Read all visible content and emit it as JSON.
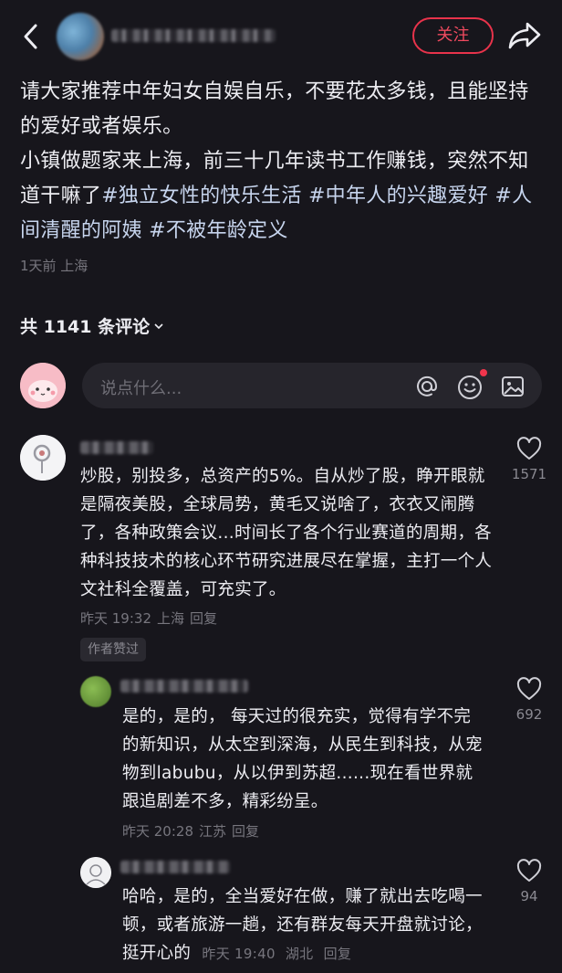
{
  "header": {
    "back_icon": "chevron-left-icon",
    "follow_label": "关注",
    "share_icon": "share-arrow-icon",
    "accent_color": "#e8334b"
  },
  "post": {
    "line1": "请大家推荐中年妇女自娱自乐，不要花太多钱，且能坚持的爱好或者娱乐。",
    "line2": "小镇做题家来上海，前三十几年读书工作赚钱，突然不知道干嘛了",
    "hashtags": [
      "#独立女性的快乐生活",
      "#中年人的兴趣爱好",
      "#人间清醒的阿姨",
      "#不被年龄定义"
    ],
    "meta": "1天前 上海"
  },
  "comments_header": {
    "label": "共 1141 条评论",
    "icon": "chevron-down-icon"
  },
  "input": {
    "placeholder": "说点什么...",
    "icons": [
      "at-icon",
      "emoji-icon",
      "image-icon"
    ]
  },
  "comments": [
    {
      "text": "炒股，别投多，总资产的5%。自从炒了股，睁开眼就是隔夜美股，全球局势，黄毛又说啥了，衣衣又闹腾了，各种政策会议...时间长了各个行业赛道的周期，各种科技技术的核心环节研究进展尽在掌握，主打一个人文社科全覆盖，可充实了。",
      "time": "昨天 19:32",
      "location": "上海",
      "reply": "回复",
      "likes": "1571",
      "badge": "作者赞过"
    },
    {
      "text": "是的，是的， 每天过的很充实，觉得有学不完的新知识，从太空到深海，从民生到科技，从宠物到labubu，从以伊到苏超......现在看世界就跟追剧差不多，精彩纷呈。",
      "time": "昨天 20:28",
      "location": "江苏",
      "reply": "回复",
      "likes": "692"
    },
    {
      "text": "哈哈，是的，全当爱好在做，赚了就出去吃喝一顿，或者旅游一趟，还有群友每天开盘就讨论，挺开心的",
      "time": "昨天 19:40",
      "location": "湖北",
      "reply": "回复",
      "likes": "94"
    }
  ]
}
